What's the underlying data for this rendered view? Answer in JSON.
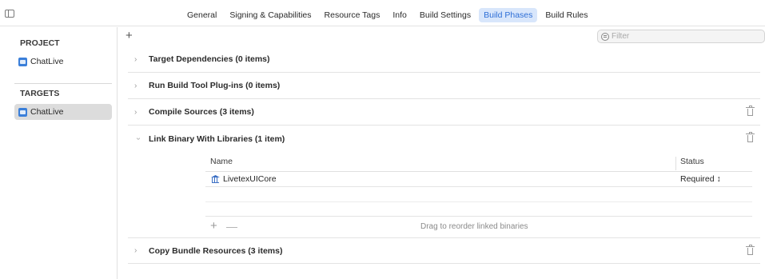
{
  "tabs": [
    {
      "label": "General",
      "active": false
    },
    {
      "label": "Signing & Capabilities",
      "active": false
    },
    {
      "label": "Resource Tags",
      "active": false
    },
    {
      "label": "Info",
      "active": false
    },
    {
      "label": "Build Settings",
      "active": false
    },
    {
      "label": "Build Phases",
      "active": true
    },
    {
      "label": "Build Rules",
      "active": false
    }
  ],
  "sidebar": {
    "project_header": "PROJECT",
    "project_item": "ChatLive",
    "targets_header": "TARGETS",
    "target_item": "ChatLive"
  },
  "toolbar": {
    "add_symbol": "+",
    "filter_placeholder": "Filter"
  },
  "phases": [
    {
      "title": "Target Dependencies (0 items)",
      "expanded": false,
      "deletable": false
    },
    {
      "title": "Run Build Tool Plug-ins (0 items)",
      "expanded": false,
      "deletable": false
    },
    {
      "title": "Compile Sources (3 items)",
      "expanded": false,
      "deletable": true
    },
    {
      "title": "Link Binary With Libraries (1 item)",
      "expanded": true,
      "deletable": true
    },
    {
      "title": "Copy Bundle Resources (3 items)",
      "expanded": false,
      "deletable": true
    }
  ],
  "libraries": {
    "col_name": "Name",
    "col_status": "Status",
    "rows": [
      {
        "name": "LivetexUICore",
        "status": "Required ↕"
      }
    ],
    "add_symbol": "+",
    "remove_symbol": "—",
    "hint": "Drag to reorder linked binaries"
  },
  "colors": {
    "accent": "#2f6fd6",
    "active_tab_bg": "#d8e6fb",
    "selection_bg": "#dcdcdc"
  },
  "icons": [
    "sidebar-toggle-icon",
    "xcodeproj-icon",
    "app-target-icon",
    "filter-icon",
    "chevron-right-icon",
    "chevron-down-icon",
    "trash-icon",
    "library-icon"
  ]
}
